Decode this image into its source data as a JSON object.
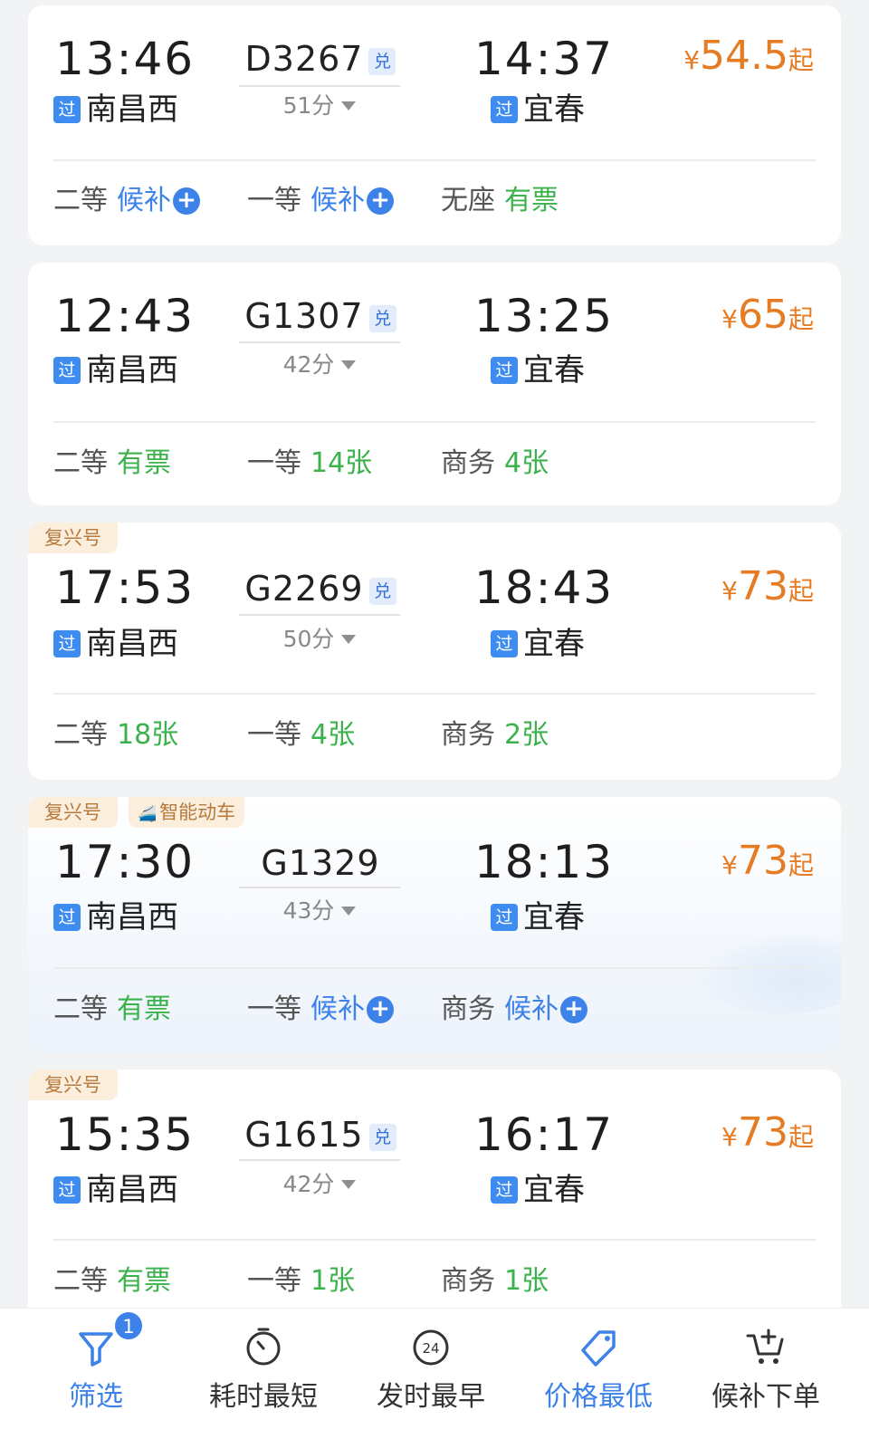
{
  "colors": {
    "accent_blue": "#3d82e8",
    "price_orange": "#e57c24",
    "available_green": "#3bb24b",
    "tag_bg": "#fbeedd",
    "tag_text": "#b77a3c"
  },
  "trains": [
    {
      "tags": [],
      "dep_time": "13:46",
      "dep_station": "南昌西",
      "dep_badge": "过",
      "train_no": "D3267",
      "exchange_badge": "兑",
      "duration": "51分",
      "arr_time": "14:37",
      "arr_station": "宜春",
      "arr_badge": "过",
      "price_symbol": "¥",
      "price": "54.5",
      "price_suffix": "起",
      "seats": [
        {
          "class": "二等",
          "status": "候补",
          "type": "waitlist"
        },
        {
          "class": "一等",
          "status": "候补",
          "type": "waitlist"
        },
        {
          "class": "无座",
          "status": "有票",
          "type": "available"
        }
      ]
    },
    {
      "tags": [],
      "dep_time": "12:43",
      "dep_station": "南昌西",
      "dep_badge": "过",
      "train_no": "G1307",
      "exchange_badge": "兑",
      "duration": "42分",
      "arr_time": "13:25",
      "arr_station": "宜春",
      "arr_badge": "过",
      "price_symbol": "¥",
      "price": "65",
      "price_suffix": "起",
      "seats": [
        {
          "class": "二等",
          "status": "有票",
          "type": "available"
        },
        {
          "class": "一等",
          "status": "14张",
          "type": "available"
        },
        {
          "class": "商务",
          "status": "4张",
          "type": "available"
        }
      ]
    },
    {
      "tags": [
        "复兴号"
      ],
      "dep_time": "17:53",
      "dep_station": "南昌西",
      "dep_badge": "过",
      "train_no": "G2269",
      "exchange_badge": "兑",
      "duration": "50分",
      "arr_time": "18:43",
      "arr_station": "宜春",
      "arr_badge": "过",
      "price_symbol": "¥",
      "price": "73",
      "price_suffix": "起",
      "seats": [
        {
          "class": "二等",
          "status": "18张",
          "type": "available"
        },
        {
          "class": "一等",
          "status": "4张",
          "type": "available"
        },
        {
          "class": "商务",
          "status": "2张",
          "type": "available"
        }
      ]
    },
    {
      "tags": [
        "复兴号",
        "智能动车"
      ],
      "dep_time": "17:30",
      "dep_station": "南昌西",
      "dep_badge": "过",
      "train_no": "G1329",
      "exchange_badge": "",
      "duration": "43分",
      "arr_time": "18:13",
      "arr_station": "宜春",
      "arr_badge": "过",
      "price_symbol": "¥",
      "price": "73",
      "price_suffix": "起",
      "seats": [
        {
          "class": "二等",
          "status": "有票",
          "type": "available"
        },
        {
          "class": "一等",
          "status": "候补",
          "type": "waitlist"
        },
        {
          "class": "商务",
          "status": "候补",
          "type": "waitlist"
        }
      ]
    },
    {
      "tags": [
        "复兴号"
      ],
      "dep_time": "15:35",
      "dep_station": "南昌西",
      "dep_badge": "过",
      "train_no": "G1615",
      "exchange_badge": "兑",
      "duration": "42分",
      "arr_time": "16:17",
      "arr_station": "宜春",
      "arr_badge": "过",
      "price_symbol": "¥",
      "price": "73",
      "price_suffix": "起",
      "seats": [
        {
          "class": "二等",
          "status": "有票",
          "type": "available"
        },
        {
          "class": "一等",
          "status": "1张",
          "type": "available"
        },
        {
          "class": "商务",
          "status": "1张",
          "type": "available"
        }
      ]
    }
  ],
  "tabbar": {
    "filter_label": "筛选",
    "filter_count": "1",
    "shortest_label": "耗时最短",
    "earliest_label": "发时最早",
    "earliest_icon_text": "24",
    "cheapest_label": "价格最低",
    "waitlist_order_label": "候补下单"
  }
}
